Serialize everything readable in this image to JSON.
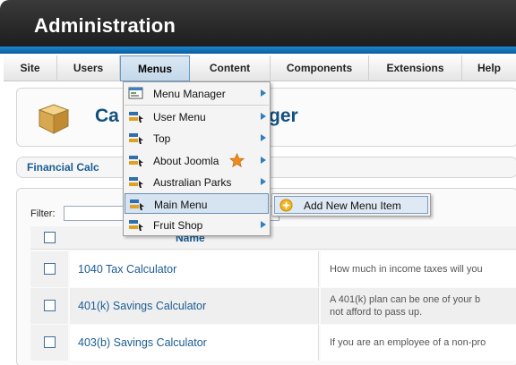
{
  "header": {
    "title": "Administration"
  },
  "menubar": {
    "items": [
      {
        "label": "Site",
        "active": false
      },
      {
        "label": "Users",
        "active": false
      },
      {
        "label": "Menus",
        "active": true
      },
      {
        "label": "Content",
        "active": false
      },
      {
        "label": "Components",
        "active": false
      },
      {
        "label": "Extensions",
        "active": false
      },
      {
        "label": "Help",
        "active": false
      }
    ]
  },
  "page": {
    "title_start": "Ca",
    "title_end": "ger"
  },
  "subtab": {
    "label": "Financial Calc"
  },
  "filter": {
    "label": "Filter:",
    "value": ""
  },
  "table": {
    "header_name": "Name",
    "rows": [
      {
        "name": "1040 Tax Calculator",
        "desc": [
          "How much in income taxes will you"
        ]
      },
      {
        "name": "401(k) Savings Calculator",
        "desc": [
          "A 401(k) plan can be one of your b",
          "not afford to pass up."
        ]
      },
      {
        "name": "403(b) Savings Calculator",
        "desc": [
          "If you are an employee of a non-pro"
        ]
      }
    ]
  },
  "dropdown": {
    "items": [
      {
        "label": "Menu Manager",
        "icon": "menu-manager-icon",
        "has_submenu": true
      },
      {
        "label": "User Menu",
        "icon": "menu-icon",
        "has_submenu": true
      },
      {
        "label": "Top",
        "icon": "menu-icon",
        "has_submenu": true
      },
      {
        "label": "About Joomla",
        "icon": "menu-icon",
        "has_submenu": true,
        "home_star": true
      },
      {
        "label": "Australian Parks",
        "icon": "menu-icon",
        "has_submenu": true
      },
      {
        "label": "Main Menu",
        "icon": "menu-icon",
        "has_submenu": false,
        "hover": true
      },
      {
        "label": "Fruit Shop",
        "icon": "menu-icon",
        "has_submenu": true
      }
    ]
  },
  "submenu": {
    "label": "Add New Menu Item",
    "icon": "add-icon"
  },
  "colors": {
    "accent": "#1b5c93",
    "header": "#222222",
    "stripe": "#1a8ad3",
    "star": "#f08a1c"
  }
}
